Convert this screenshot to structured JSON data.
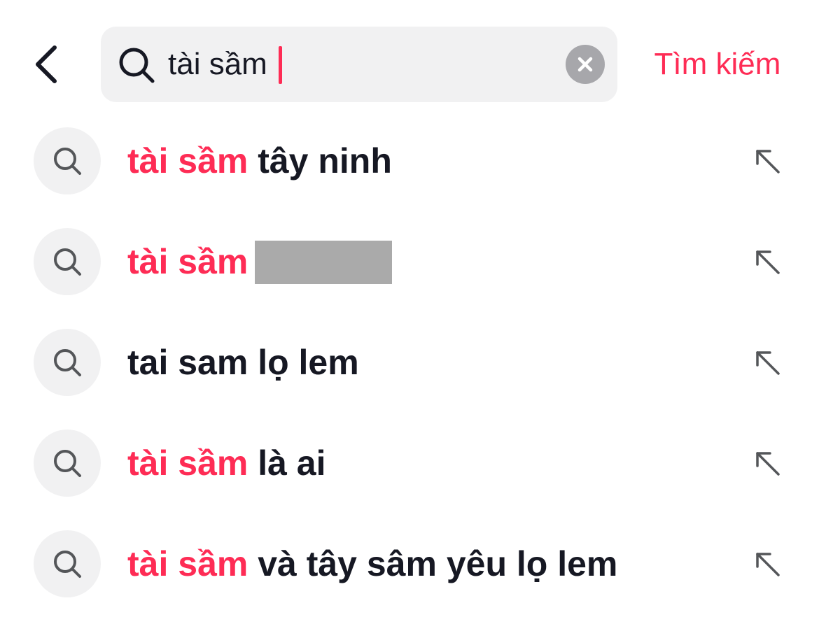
{
  "colors": {
    "accent": "#fe2c55",
    "text": "#161823",
    "field_bg": "#f1f1f2",
    "clear_bg": "#a7a7ab",
    "redaction": "#aaaaaa"
  },
  "header": {
    "back_icon": "chevron-left-icon",
    "search": {
      "value": "tài sầm",
      "icon": "search-icon",
      "clear_icon": "close-icon"
    },
    "submit_label": "Tìm kiếm"
  },
  "suggestions": [
    {
      "highlight": "tài sầm",
      "rest": "tây ninh",
      "redacted": false
    },
    {
      "highlight": "tài sầm",
      "rest": "",
      "redacted": true
    },
    {
      "highlight": "",
      "rest": "tai sam lọ lem",
      "redacted": false
    },
    {
      "highlight": "tài sầm",
      "rest": "là ai",
      "redacted": false
    },
    {
      "highlight": "tài sầm",
      "rest": "và tây sâm yêu lọ lem",
      "redacted": false
    }
  ],
  "suggestion_icons": {
    "leading": "search-icon",
    "trailing": "arrow-up-left-icon"
  }
}
